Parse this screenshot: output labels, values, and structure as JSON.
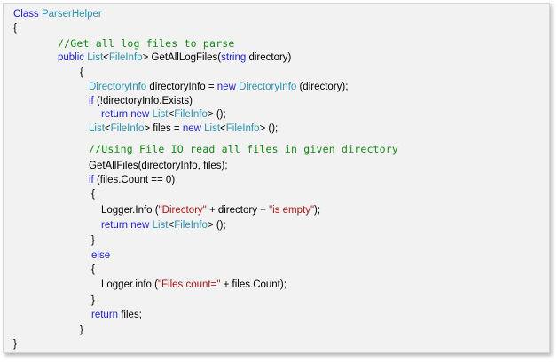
{
  "code_lines": [
    [
      {
        "t": "Class",
        "c": "kw"
      },
      {
        "t": " "
      },
      {
        "t": "ParserHelper",
        "c": "ty"
      }
    ],
    [
      {
        "t": "{"
      }
    ],
    [
      {
        "t": "//Get all log files to parse",
        "c": "cm"
      }
    ],
    [
      {
        "t": "public",
        "c": "kw"
      },
      {
        "t": " "
      },
      {
        "t": "List",
        "c": "ty"
      },
      {
        "t": "<"
      },
      {
        "t": "FileInfo",
        "c": "ty"
      },
      {
        "t": "> GetAllLogFiles("
      },
      {
        "t": "string",
        "c": "kw"
      },
      {
        "t": " directory)"
      }
    ],
    [
      {
        "t": "{"
      }
    ],
    [
      {
        "t": "DirectoryInfo",
        "c": "ty"
      },
      {
        "t": " directoryInfo = "
      },
      {
        "t": "new",
        "c": "kw"
      },
      {
        "t": " "
      },
      {
        "t": "DirectoryInfo",
        "c": "ty"
      },
      {
        "t": " (directory);"
      }
    ],
    [
      {
        "t": "if",
        "c": "kw"
      },
      {
        "t": " (!directoryInfo.Exists)"
      }
    ],
    [
      {
        "t": "return",
        "c": "kw"
      },
      {
        "t": " "
      },
      {
        "t": "new",
        "c": "kw"
      },
      {
        "t": " "
      },
      {
        "t": "List",
        "c": "ty"
      },
      {
        "t": "<"
      },
      {
        "t": "FileInfo",
        "c": "ty"
      },
      {
        "t": "> ();"
      }
    ],
    [
      {
        "t": "List",
        "c": "ty"
      },
      {
        "t": "<"
      },
      {
        "t": "FileInfo",
        "c": "ty"
      },
      {
        "t": "> files = "
      },
      {
        "t": "new",
        "c": "kw"
      },
      {
        "t": " "
      },
      {
        "t": "List",
        "c": "ty"
      },
      {
        "t": "<"
      },
      {
        "t": "FileInfo",
        "c": "ty"
      },
      {
        "t": "> ();"
      }
    ],
    [
      {
        "t": "//Using File IO read all files in given directory",
        "c": "cm"
      }
    ],
    [
      {
        "t": "GetAllFiles(directoryInfo, files);"
      }
    ],
    [
      {
        "t": "if",
        "c": "kw"
      },
      {
        "t": " (files.Count == 0)"
      }
    ],
    [
      {
        "t": "{"
      }
    ],
    [
      {
        "t": "Logger.Info ("
      },
      {
        "t": "\"Directory\"",
        "c": "st"
      },
      {
        "t": " + directory + "
      },
      {
        "t": "\"is empty\"",
        "c": "st"
      },
      {
        "t": ");"
      }
    ],
    [
      {
        "t": "return",
        "c": "kw"
      },
      {
        "t": " "
      },
      {
        "t": "new",
        "c": "kw"
      },
      {
        "t": " "
      },
      {
        "t": "List",
        "c": "ty"
      },
      {
        "t": "<"
      },
      {
        "t": "FileInfo",
        "c": "ty"
      },
      {
        "t": "> ();"
      }
    ],
    [
      {
        "t": "}"
      }
    ],
    [
      {
        "t": "else",
        "c": "kw"
      }
    ],
    [
      {
        "t": "{"
      }
    ],
    [
      {
        "t": "Logger.info ("
      },
      {
        "t": "\"Files count=\"",
        "c": "st"
      },
      {
        "t": " + files.Count);"
      }
    ],
    [
      {
        "t": "}"
      }
    ],
    [
      {
        "t": "return",
        "c": "kw"
      },
      {
        "t": " files;"
      }
    ],
    [
      {
        "t": "}"
      }
    ],
    [
      {
        "t": "}"
      }
    ]
  ],
  "colors": {
    "keyword": "#1f1fcf",
    "type": "#2b91af",
    "string": "#a31515",
    "comment": "#138a13",
    "background": "#f2f2f2"
  }
}
